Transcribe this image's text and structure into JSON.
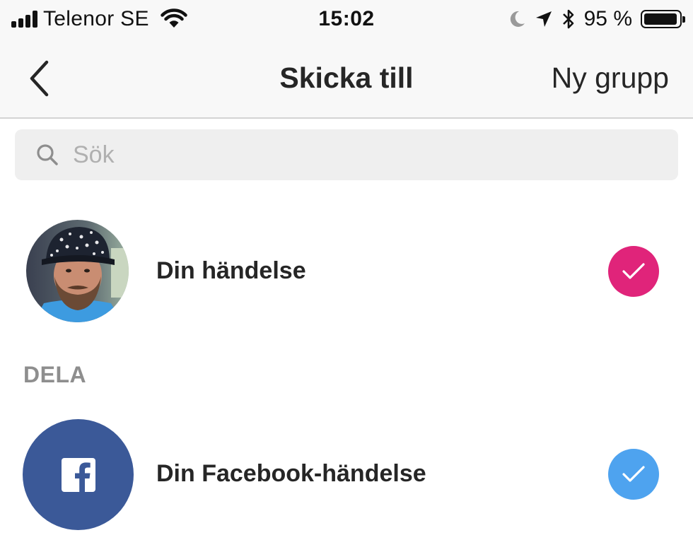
{
  "status_bar": {
    "carrier": "Telenor SE",
    "time": "15:02",
    "battery_percent": "95 %",
    "battery_level": 0.95,
    "icons": [
      "signal-icon",
      "wifi-icon",
      "moon-icon",
      "location-icon",
      "bluetooth-icon",
      "battery-icon"
    ]
  },
  "nav": {
    "title": "Skicka till",
    "action": "Ny grupp",
    "back_icon": "chevron-left-icon"
  },
  "search": {
    "placeholder": "Sök",
    "value": "",
    "icon": "search-icon"
  },
  "rows": {
    "story": {
      "label": "Din händelse",
      "selected": true,
      "check_color": "#e0247a"
    }
  },
  "share_section": {
    "header": "DELA",
    "items": [
      {
        "label": "Din Facebook-händelse",
        "icon": "facebook-icon",
        "selected": true,
        "check_color": "#4ea3ef"
      }
    ]
  },
  "colors": {
    "facebook_blue": "#3b5998",
    "accent_pink": "#e0247a",
    "accent_blue": "#4ea3ef",
    "bar_bg": "#f8f8f8"
  }
}
